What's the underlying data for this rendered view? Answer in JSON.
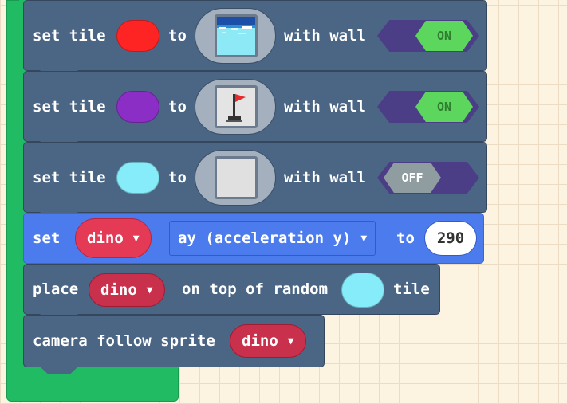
{
  "blocks": {
    "set_tile_1": {
      "set_tile": "set tile",
      "to": "to",
      "with_wall": "with wall",
      "tile_color": "#ff2424",
      "wall_state": "ON"
    },
    "set_tile_2": {
      "set_tile": "set tile",
      "to": "to",
      "with_wall": "with wall",
      "tile_color": "#8a2ec5",
      "wall_state": "ON"
    },
    "set_tile_3": {
      "set_tile": "set tile",
      "to": "to",
      "with_wall": "with wall",
      "tile_color": "#86ecfa",
      "wall_state": "OFF"
    },
    "set_prop": {
      "set": "set",
      "sprite": "dino",
      "property": "ay (acceleration y)",
      "to": "to",
      "value": "290"
    },
    "place": {
      "place": "place",
      "sprite": "dino",
      "on_top": "on top of random",
      "tile": "tile",
      "tile_color": "#86ecfa"
    },
    "camera": {
      "label": "camera follow sprite",
      "sprite": "dino"
    }
  },
  "icons": {
    "caret": "▼",
    "tile_images": [
      "water-tile-icon",
      "flag-tile-icon",
      "blank-tile-icon"
    ]
  },
  "colors": {
    "toggle_on": "#5cd65c",
    "toggle_off": "#8f9ca0",
    "block": "#4b6584",
    "sprites_block": "#4b7bec",
    "loops_frame": "#21bb63"
  }
}
